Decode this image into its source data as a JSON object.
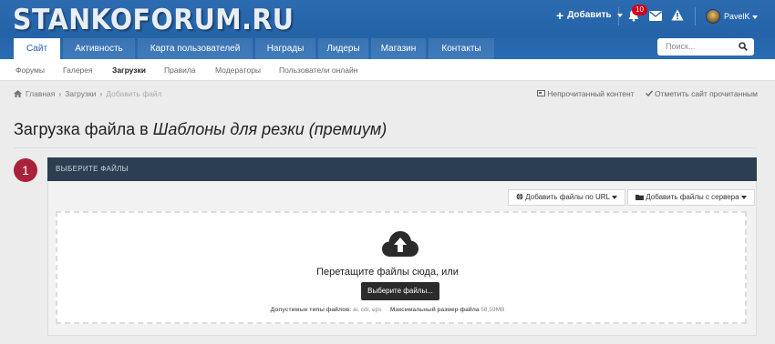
{
  "header": {
    "logo": "STANKOFORUM.RU",
    "add_label": "Добавить",
    "notification_count": "10",
    "username": "PavelK"
  },
  "nav": {
    "tabs": [
      {
        "label": "Сайт",
        "active": true
      },
      {
        "label": "Активность",
        "active": false
      },
      {
        "label": "Карта пользователей",
        "active": false
      },
      {
        "label": "Награды",
        "active": false
      },
      {
        "label": "Лидеры",
        "active": false
      },
      {
        "label": "Магазин",
        "active": false
      },
      {
        "label": "Контакты",
        "active": false
      }
    ],
    "search_placeholder": "Поиск..."
  },
  "subnav": {
    "items": [
      "Форумы",
      "Галерея",
      "Загрузки",
      "Правила",
      "Модераторы",
      "Пользователи онлайн"
    ],
    "active": "Загрузки"
  },
  "breadcrumb": {
    "items": [
      "Главная",
      "Загрузки",
      "Добавить файл"
    ],
    "unread_label": "Непрочитанный контент",
    "mark_read_label": "Отметить сайт прочитанным"
  },
  "page": {
    "title_prefix": "Загрузка файла в ",
    "title_category": "Шаблоны для резки (премиум)"
  },
  "step": {
    "number": "1",
    "heading": "ВЫБЕРИТЕ ФАЙЛЫ",
    "add_url_label": "Добавить файлы по URL",
    "add_server_label": "Добавить файлы с сервера",
    "drop_text": "Перетащите файлы сюда, или",
    "choose_label": "Выберите файлы...",
    "allowed_types_label": "Допустимые типы файлов:",
    "allowed_types": "ai, cdr, eps",
    "max_size_label": "Максимальный размер файла",
    "max_size": "58,59MB"
  },
  "colors": {
    "header_blue": "#2563a8",
    "panel_head": "#2c3e51",
    "step_badge": "#a7223a",
    "choose_button": "#2b2b2b"
  }
}
